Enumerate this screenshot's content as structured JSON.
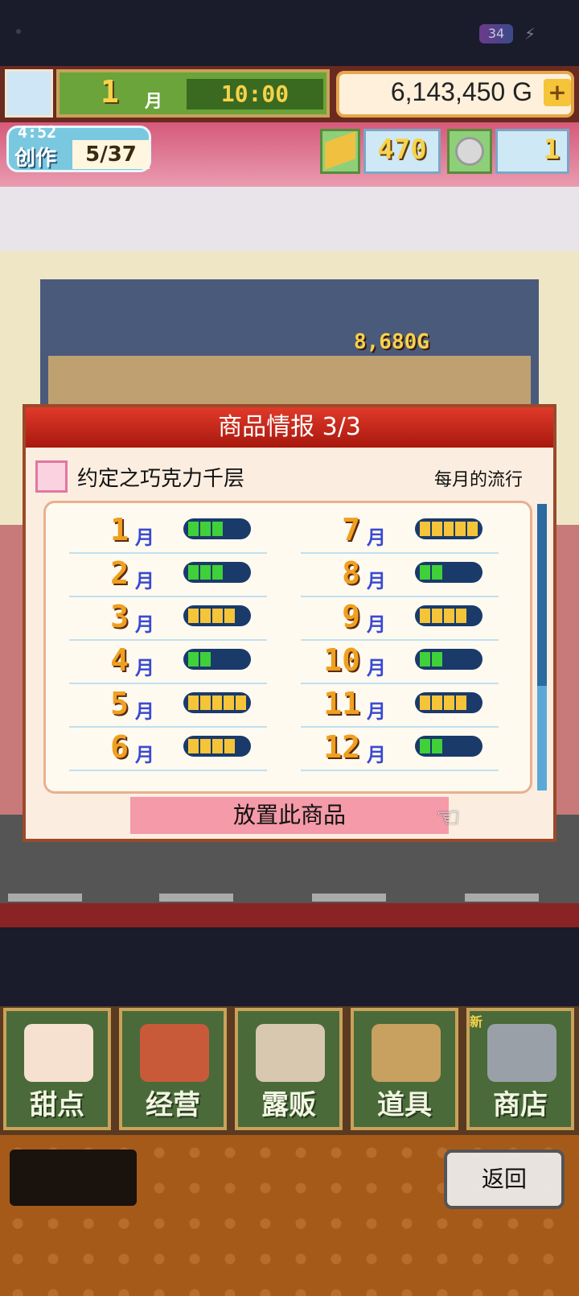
{
  "status": {
    "battery": "34"
  },
  "topbar": {
    "month_num": "1",
    "month_unit": "月",
    "time": "10:00",
    "gold": "6,143,450 G",
    "plus": "+"
  },
  "resources": {
    "clock": "4:52",
    "create_label": "创作",
    "create_count": "5/37",
    "tickets": "470",
    "coins": "1"
  },
  "scene": {
    "price_float": "8,680G"
  },
  "dialog": {
    "title": "商品情报 3/3",
    "product_name": "约定之巧克力千层",
    "trend_label": "每月的流行",
    "place_button": "放置此商品",
    "month_unit": "月",
    "months": [
      {
        "num": "1",
        "level": 3
      },
      {
        "num": "2",
        "level": 3
      },
      {
        "num": "3",
        "level": 4
      },
      {
        "num": "4",
        "level": 2
      },
      {
        "num": "5",
        "level": 5
      },
      {
        "num": "6",
        "level": 4
      },
      {
        "num": "7",
        "level": 5
      },
      {
        "num": "8",
        "level": 2
      },
      {
        "num": "9",
        "level": 4
      },
      {
        "num": "10",
        "level": 2
      },
      {
        "num": "11",
        "level": 4
      },
      {
        "num": "12",
        "level": 2
      }
    ]
  },
  "menu": {
    "items": [
      {
        "label": "甜点",
        "icon": "cake-icon"
      },
      {
        "label": "经营",
        "icon": "shop-icon"
      },
      {
        "label": "露贩",
        "icon": "food-truck-icon"
      },
      {
        "label": "道具",
        "icon": "gear-bag-icon"
      },
      {
        "label": "商店",
        "icon": "cart-icon"
      }
    ],
    "new_badge": "新"
  },
  "footer": {
    "back_label": "返回"
  },
  "colors": {
    "green_seg": "#3fd03a",
    "gold_seg": "#f5c438",
    "bar_bg": "#1a3a6a"
  }
}
